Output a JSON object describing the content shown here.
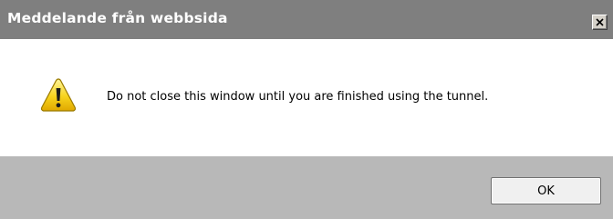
{
  "window": {
    "title": "Meddelande från webbsida",
    "close_icon": "close-icon"
  },
  "dialog": {
    "icon": "warning-icon",
    "message": "Do not close this window until you are finished using the tunnel."
  },
  "buttons": {
    "ok_label": "OK"
  },
  "colors": {
    "titlebar": "#7f7f7f",
    "footer": "#b8b8b8",
    "warning_yellow": "#f7d31c"
  }
}
